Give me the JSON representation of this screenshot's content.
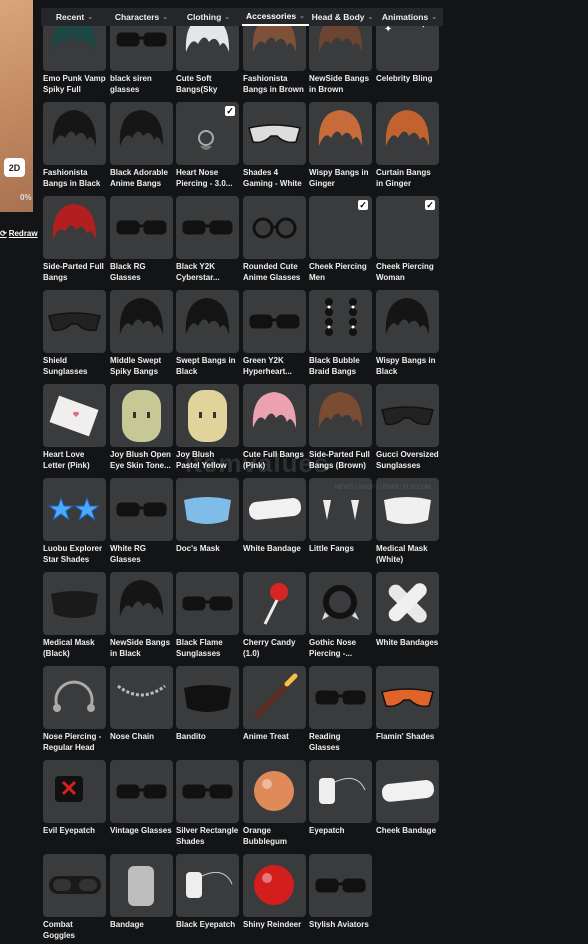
{
  "tabs": [
    {
      "label": "Recent"
    },
    {
      "label": "Characters"
    },
    {
      "label": "Clothing"
    },
    {
      "label": "Accessories",
      "active": true
    },
    {
      "label": "Head & Body"
    },
    {
      "label": "Animations"
    }
  ],
  "left": {
    "view_mode": "2D",
    "percent": "0%",
    "redraw": "Redraw"
  },
  "watermark": {
    "text": "itemvalues",
    "sub": "NEWS / SHOP / ITEMS / FLIP.COM"
  },
  "items": [
    {
      "name": "Emo Punk Vamp Spiky Full Bang...",
      "icon": "hair-icon",
      "checked": true
    },
    {
      "name": "black siren glasses",
      "icon": "glasses-icon",
      "checked": true
    },
    {
      "name": "Cute Soft Bangs(Sky Blue)",
      "icon": "hair-icon",
      "checked": false
    },
    {
      "name": "Fashionista Bangs in Brown",
      "icon": "hair-icon",
      "checked": false
    },
    {
      "name": "NewSide Bangs in Brown",
      "icon": "hair-icon",
      "checked": false
    },
    {
      "name": "Celebrity Bling",
      "icon": "sparkle-icon",
      "checked": false
    },
    {
      "name": "Fashionista Bangs in Black",
      "icon": "hair-icon",
      "checked": false
    },
    {
      "name": "Black Adorable Anime Bangs",
      "icon": "hair-icon",
      "checked": false
    },
    {
      "name": "Heart Nose Piercing - 3.0...",
      "icon": "piercing-icon",
      "checked": true
    },
    {
      "name": "Shades 4 Gaming - White",
      "icon": "shades-icon",
      "checked": false
    },
    {
      "name": "Wispy Bangs in Ginger",
      "icon": "hair-icon",
      "checked": false
    },
    {
      "name": "Curtain Bangs in Ginger",
      "icon": "hair-icon",
      "checked": false
    },
    {
      "name": "Side-Parted Full Bangs (Crimso...",
      "icon": "hair-icon",
      "checked": false
    },
    {
      "name": "Black RG Glasses",
      "icon": "glasses-icon",
      "checked": false
    },
    {
      "name": "Black Y2K Cyberstar...",
      "icon": "glasses-icon",
      "checked": false
    },
    {
      "name": "Rounded Cute Anime Glasses",
      "icon": "round-glasses-icon",
      "checked": false
    },
    {
      "name": "Cheek Piercing Men",
      "icon": "piercing-icon",
      "checked": true
    },
    {
      "name": "Cheek Piercing Woman",
      "icon": "piercing-icon",
      "checked": true
    },
    {
      "name": "Shield Sunglasses",
      "icon": "shades-icon",
      "checked": false
    },
    {
      "name": "Middle Swept Spiky Bangs in...",
      "icon": "hair-icon",
      "checked": false
    },
    {
      "name": "Swept Bangs in Black",
      "icon": "hair-icon",
      "checked": false
    },
    {
      "name": "Green Y2K Hyperheart...",
      "icon": "glasses-icon",
      "checked": false
    },
    {
      "name": "Black Bubble Braid Bangs",
      "icon": "braid-icon",
      "checked": false
    },
    {
      "name": "Wispy Bangs in Black",
      "icon": "hair-icon",
      "checked": false
    },
    {
      "name": "Heart Love Letter (Pink)",
      "icon": "letter-icon",
      "checked": false
    },
    {
      "name": "Joy Blush Open Eye Skin Tone...",
      "icon": "head-icon",
      "checked": false
    },
    {
      "name": "Joy Blush Pastel Yellow Tone Ski...",
      "icon": "head-icon",
      "checked": false
    },
    {
      "name": "Cute Full Bangs (Pink)",
      "icon": "hair-icon",
      "checked": false
    },
    {
      "name": "Side-Parted Full Bangs (Brown)",
      "icon": "hair-icon",
      "checked": false
    },
    {
      "name": "Gucci Oversized Sunglasses",
      "icon": "shades-icon",
      "checked": false
    },
    {
      "name": "Luobu Explorer Star Shades",
      "icon": "star-glasses-icon",
      "checked": false
    },
    {
      "name": "White RG Glasses",
      "icon": "glasses-icon",
      "checked": false
    },
    {
      "name": "Doc's Mask",
      "icon": "mask-icon",
      "checked": false
    },
    {
      "name": "White Bandage",
      "icon": "bandage-icon",
      "checked": false
    },
    {
      "name": "Little Fangs",
      "icon": "fangs-icon",
      "checked": false
    },
    {
      "name": "Medical Mask (White)",
      "icon": "mask-icon",
      "checked": false
    },
    {
      "name": "Medical Mask (Black)",
      "icon": "mask-icon",
      "checked": false
    },
    {
      "name": "NewSide Bangs in Black",
      "icon": "hair-icon",
      "checked": false
    },
    {
      "name": "Black Flame Sunglasses",
      "icon": "glasses-icon",
      "checked": false
    },
    {
      "name": "Cherry Candy (1.0)",
      "icon": "lollipop-icon",
      "checked": false
    },
    {
      "name": "Gothic Nose Piercing -...",
      "icon": "ring-icon",
      "checked": false
    },
    {
      "name": "White Bandages",
      "icon": "bandage-icon",
      "checked": false
    },
    {
      "name": "Nose Piercing - Regular Head",
      "icon": "ring-icon",
      "checked": false
    },
    {
      "name": "Nose Chain",
      "icon": "chain-icon",
      "checked": false
    },
    {
      "name": "Bandito",
      "icon": "mask-icon",
      "checked": false
    },
    {
      "name": "Anime Treat",
      "icon": "treat-icon",
      "checked": false
    },
    {
      "name": "Reading Glasses",
      "icon": "glasses-icon",
      "checked": false
    },
    {
      "name": "Flamin' Shades",
      "icon": "shades-icon",
      "checked": false
    },
    {
      "name": "Evil Eyepatch",
      "icon": "eyepatch-icon",
      "checked": false
    },
    {
      "name": "Vintage Glasses",
      "icon": "glasses-icon",
      "checked": false
    },
    {
      "name": "Silver Rectangle Shades",
      "icon": "glasses-icon",
      "checked": false
    },
    {
      "name": "Orange Bubblegum",
      "icon": "bubble-icon",
      "checked": false
    },
    {
      "name": "Eyepatch",
      "icon": "eyepatch-icon",
      "checked": false
    },
    {
      "name": "Cheek Bandage",
      "icon": "bandage-icon",
      "checked": false
    },
    {
      "name": "Combat Goggles",
      "icon": "goggles-icon",
      "checked": false
    },
    {
      "name": "Bandage",
      "icon": "bandage-icon",
      "checked": false
    },
    {
      "name": "Black Eyepatch",
      "icon": "eyepatch-icon",
      "checked": false
    },
    {
      "name": "Shiny Reindeer",
      "icon": "bubble-icon",
      "checked": false
    },
    {
      "name": "Stylish Aviators",
      "icon": "glasses-icon",
      "checked": false
    }
  ]
}
